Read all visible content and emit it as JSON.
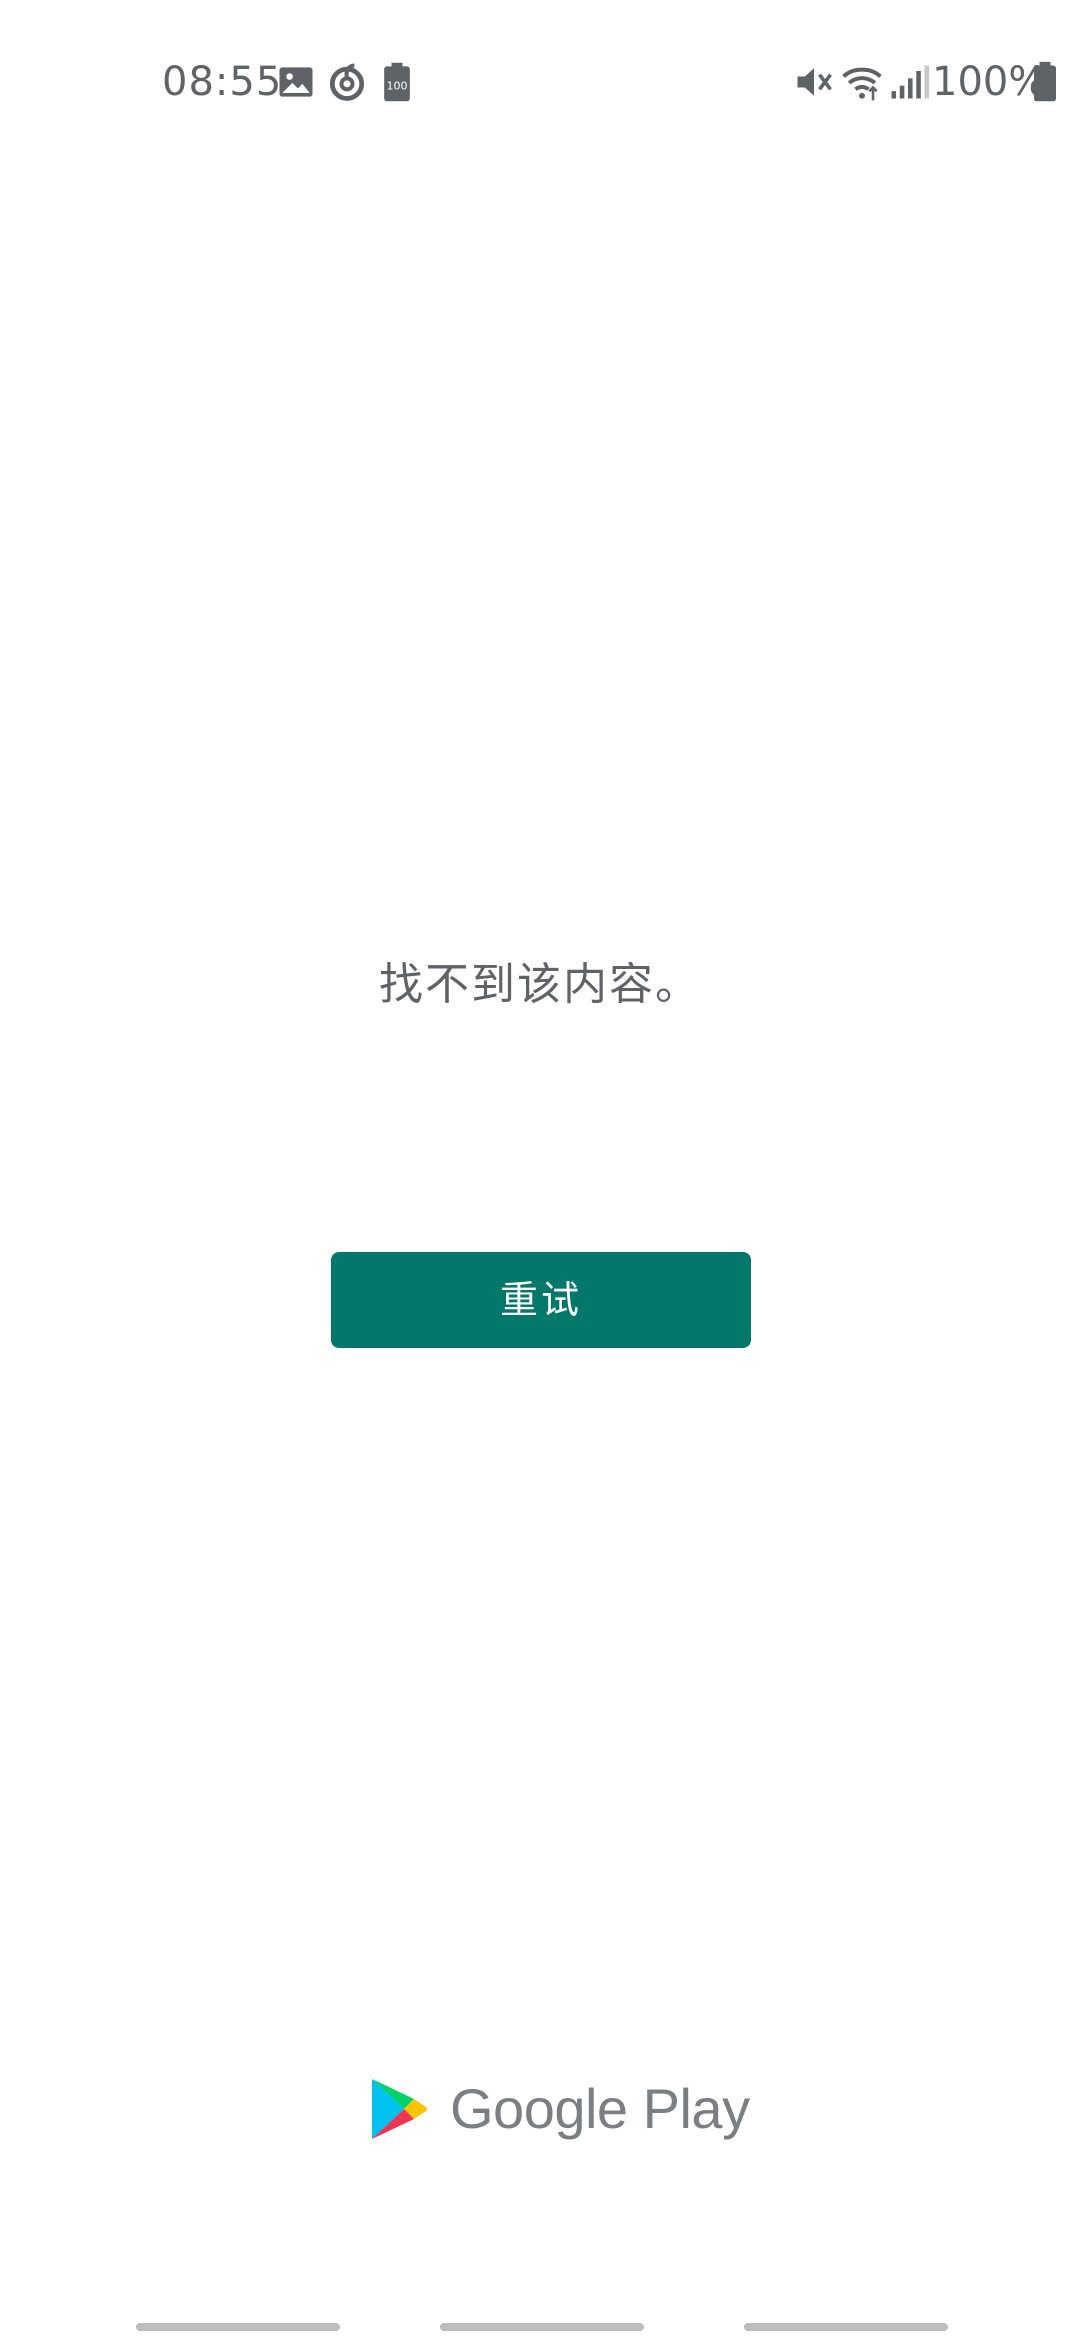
{
  "status_bar": {
    "time": "08:55",
    "left_icons": [
      "image-icon",
      "netease-music-icon",
      "battery-100-icon"
    ],
    "right_icons": [
      "mute-icon",
      "wifi-icon",
      "signal-icon"
    ],
    "battery_text": "100%",
    "battery_badge": "100"
  },
  "main": {
    "message": "找不到该内容。",
    "retry_label": "重试"
  },
  "footer": {
    "brand_text": "Google Play",
    "logo_icon": "google-play-icon"
  },
  "colors": {
    "button": "#01786a",
    "text": "#5f6368",
    "background": "#ffffff"
  }
}
